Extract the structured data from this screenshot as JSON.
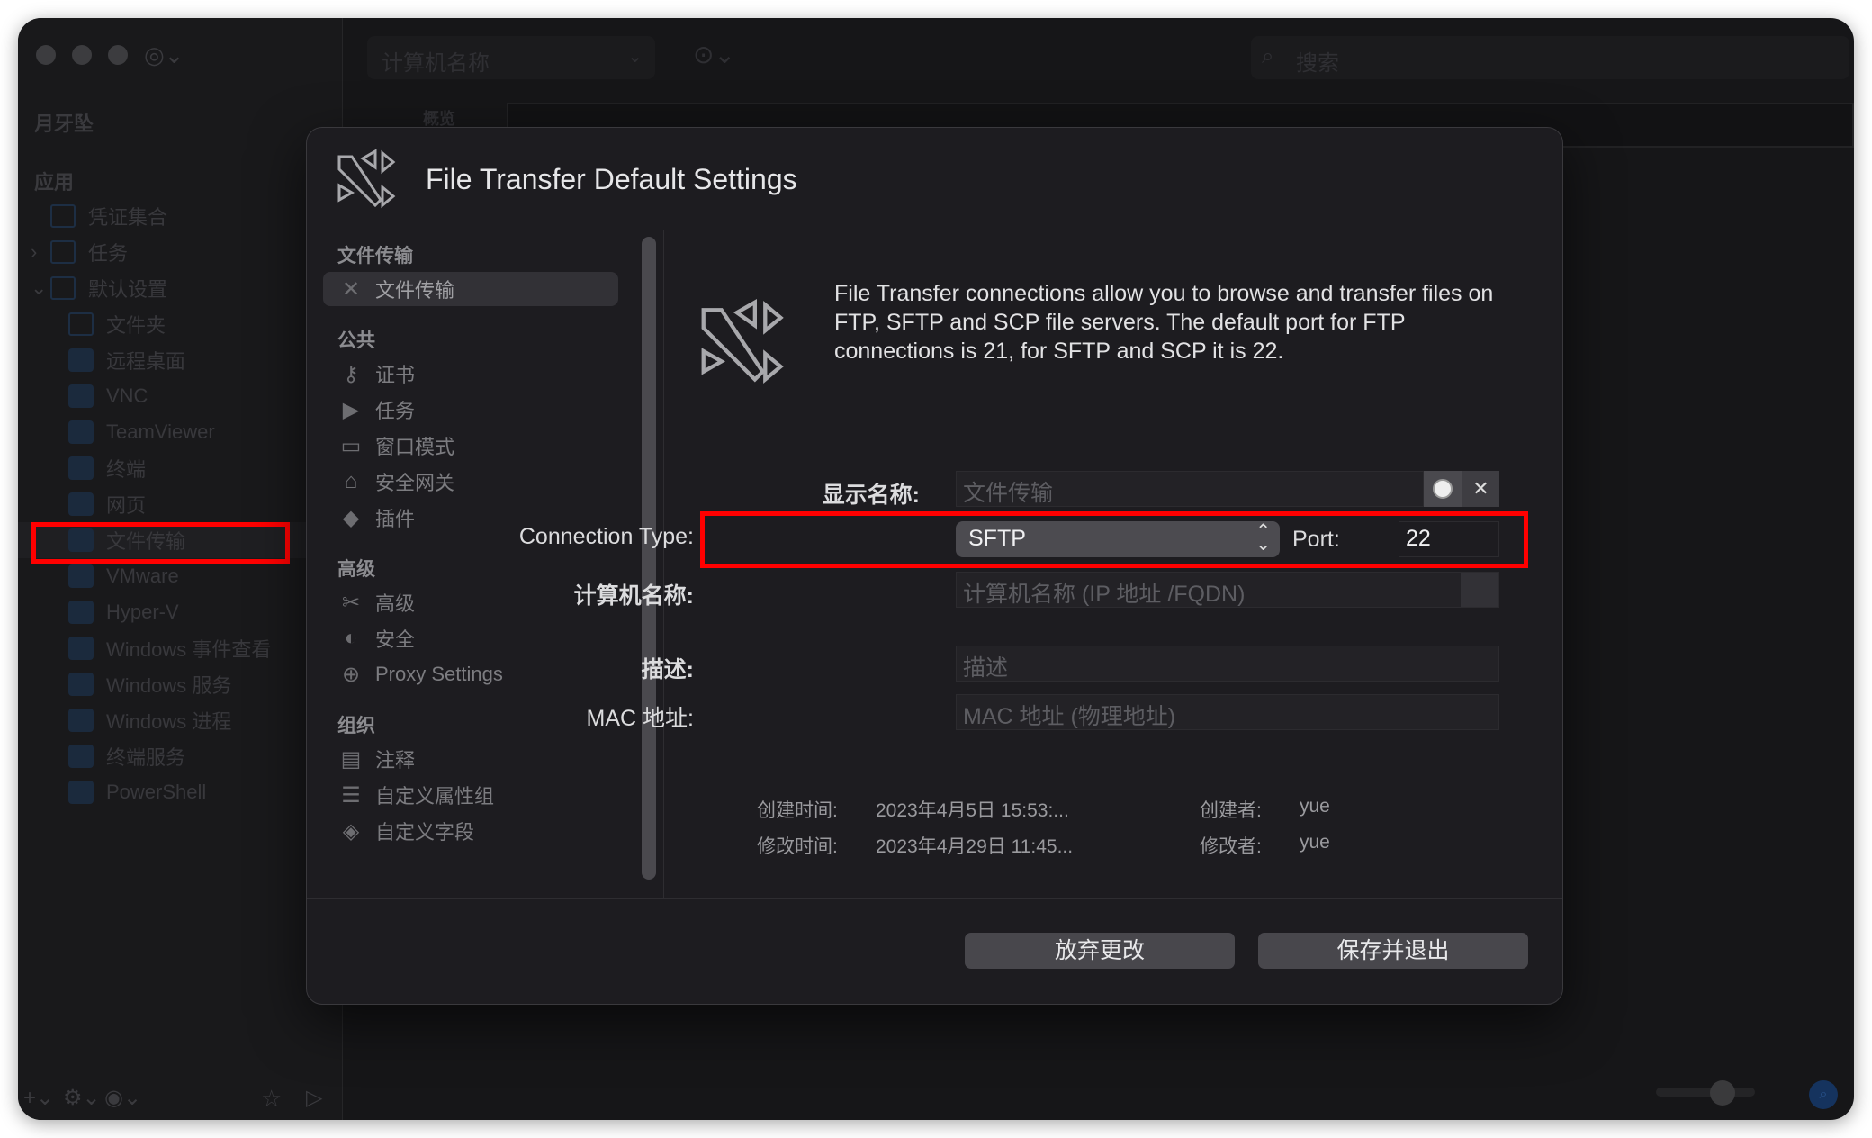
{
  "window": {
    "computer_name_placeholder": "计算机名称",
    "search_placeholder": "搜索",
    "tab_overview": "概览"
  },
  "sidebar": {
    "title": "月牙坠",
    "section": "应用",
    "items": [
      {
        "label": "凭证集合",
        "icon": "folder-icon"
      },
      {
        "label": "任务",
        "icon": "folder-icon"
      },
      {
        "label": "默认设置",
        "icon": "folder-icon"
      },
      {
        "label": "文件夹",
        "icon": "folder-icon"
      },
      {
        "label": "远程桌面",
        "icon": "cube-icon"
      },
      {
        "label": "VNC",
        "icon": "cube-icon"
      },
      {
        "label": "TeamViewer",
        "icon": "cube-icon"
      },
      {
        "label": "终端",
        "icon": "terminal-icon"
      },
      {
        "label": "网页",
        "icon": "cube-icon"
      },
      {
        "label": "文件传输",
        "icon": "file-transfer-icon"
      },
      {
        "label": "VMware",
        "icon": "cube-icon"
      },
      {
        "label": "Hyper-V",
        "icon": "cube-icon"
      },
      {
        "label": "Windows 事件查看",
        "icon": "cube-icon"
      },
      {
        "label": "Windows 服务",
        "icon": "cube-icon"
      },
      {
        "label": "Windows 进程",
        "icon": "cube-icon"
      },
      {
        "label": "终端服务",
        "icon": "cube-icon"
      },
      {
        "label": "PowerShell",
        "icon": "cube-icon"
      }
    ]
  },
  "dialog": {
    "title": "File Transfer Default Settings",
    "nav": {
      "sections": [
        {
          "heading": "文件传输",
          "items": [
            {
              "label": "文件传输",
              "icon": "file-transfer-icon",
              "selected": true
            }
          ]
        },
        {
          "heading": "公共",
          "items": [
            {
              "label": "证书",
              "icon": "key-icon"
            },
            {
              "label": "任务",
              "icon": "tasks-icon"
            },
            {
              "label": "窗口模式",
              "icon": "window-icon"
            },
            {
              "label": "安全网关",
              "icon": "gateway-icon"
            },
            {
              "label": "插件",
              "icon": "plugin-icon"
            }
          ]
        },
        {
          "heading": "高级",
          "items": [
            {
              "label": "高级",
              "icon": "tools-icon"
            },
            {
              "label": "安全",
              "icon": "shield-icon"
            },
            {
              "label": "Proxy Settings",
              "icon": "globe-icon"
            }
          ]
        },
        {
          "heading": "组织",
          "items": [
            {
              "label": "注释",
              "icon": "document-icon"
            },
            {
              "label": "自定义属性组",
              "icon": "list-icon"
            },
            {
              "label": "自定义字段",
              "icon": "tag-icon"
            }
          ]
        }
      ]
    },
    "description": "File Transfer connections allow you to browse and transfer files on FTP, SFTP and SCP file servers. The default port for FTP connections is 21, for SFTP and SCP it is 22.",
    "form": {
      "display_name_label": "显示名称:",
      "display_name_placeholder": "文件传输",
      "connection_type_label": "Connection Type:",
      "connection_type_value": "SFTP",
      "port_label": "Port:",
      "port_value": "22",
      "computer_name_label": "计算机名称:",
      "computer_name_placeholder": "计算机名称 (IP 地址 /FQDN)",
      "description_label": "描述:",
      "description_placeholder": "描述",
      "mac_label": "MAC 地址:",
      "mac_placeholder": "MAC 地址 (物理地址)"
    },
    "meta": {
      "created_label": "创建时间:",
      "created_value": "2023年4月5日 15:53:...",
      "creator_label": "创建者:",
      "creator_value": "yue",
      "modified_label": "修改时间:",
      "modified_value": "2023年4月29日 11:45...",
      "modifier_label": "修改者:",
      "modifier_value": "yue"
    },
    "buttons": {
      "discard": "放弃更改",
      "save": "保存并退出"
    }
  },
  "colors": {
    "highlight": "#ff0000",
    "background": "#161618",
    "dialog": "#1d1c20"
  }
}
